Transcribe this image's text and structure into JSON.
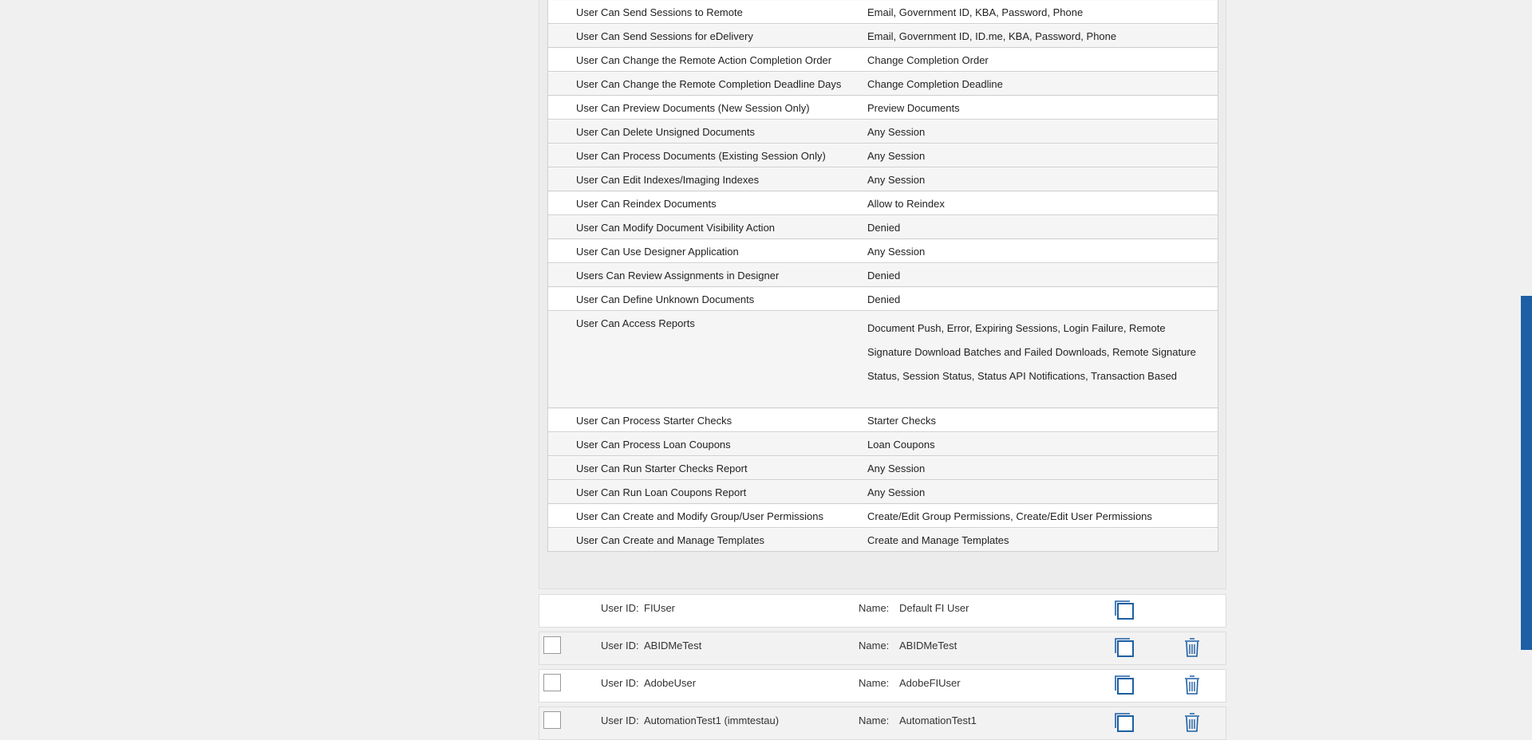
{
  "permissions": [
    {
      "name": "User Can Send Sessions to Remote",
      "value": "Email, Government ID, KBA, Password, Phone"
    },
    {
      "name": "User Can Send Sessions for eDelivery",
      "value": "Email, Government ID, ID.me, KBA, Password, Phone"
    },
    {
      "name": "User Can Change the Remote Action Completion Order",
      "value": "Change Completion Order"
    },
    {
      "name": "User Can Change the Remote Completion Deadline Days",
      "value": "Change Completion Deadline"
    },
    {
      "name": "User Can Preview Documents (New Session Only)",
      "value": "Preview Documents"
    },
    {
      "name": "User Can Delete Unsigned Documents",
      "value": "Any Session"
    },
    {
      "name": "User Can Process Documents (Existing Session Only)",
      "value": "Any Session"
    },
    {
      "name": "User Can Edit Indexes/Imaging Indexes",
      "value": "Any Session"
    },
    {
      "name": "User Can Reindex Documents",
      "value": "Allow to Reindex"
    },
    {
      "name": "User Can Modify Document Visibility Action",
      "value": "Denied"
    },
    {
      "name": "User Can Use Designer Application",
      "value": "Any Session"
    },
    {
      "name": "Users Can Review Assignments in Designer",
      "value": "Denied"
    },
    {
      "name": "User Can Define Unknown Documents",
      "value": "Denied"
    },
    {
      "name": "User Can Access Reports",
      "value": "Document Push, Error, Expiring Sessions, Login Failure, Remote Signature Download Batches and Failed Downloads, Remote Signature Status, Session Status, Status API Notifications, Transaction Based"
    },
    {
      "name": "User Can Process Starter Checks",
      "value": "Starter Checks"
    },
    {
      "name": "User Can Process Loan Coupons",
      "value": "Loan Coupons"
    },
    {
      "name": "User Can Run Starter Checks Report",
      "value": "Any Session"
    },
    {
      "name": "User Can Run Loan Coupons Report",
      "value": "Any Session"
    },
    {
      "name": "User Can Create and Modify Group/User Permissions",
      "value": "Create/Edit Group Permissions, Create/Edit User Permissions"
    },
    {
      "name": "User Can Create and Manage Templates",
      "value": "Create and Manage Templates"
    }
  ],
  "users": {
    "user_id_label": "User ID:",
    "name_label": "Name:",
    "rows": [
      {
        "user_id": "FIUser",
        "name": "Default FI User"
      },
      {
        "user_id": "ABIDMeTest",
        "name": "ABIDMeTest"
      },
      {
        "user_id": "AdobeUser",
        "name": "AdobeFIUser"
      },
      {
        "user_id": "AutomationTest1 (immtestau)",
        "name": "AutomationTest1"
      }
    ]
  },
  "colors": {
    "accent": "#1d5fa4",
    "row_alt": "#f5f5f5",
    "background": "#f0f0f0"
  },
  "icons": [
    "copy-icon",
    "trash-icon"
  ]
}
